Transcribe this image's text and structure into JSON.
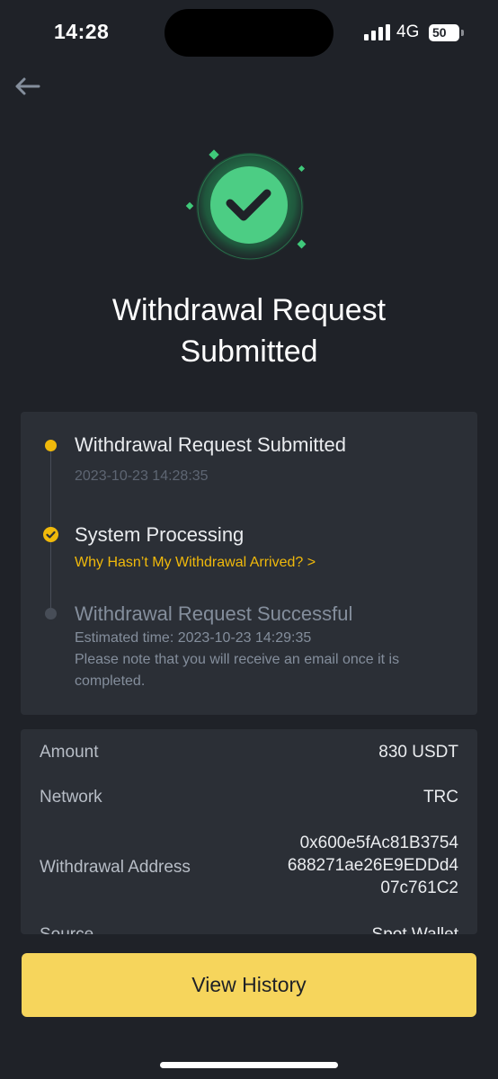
{
  "status_bar": {
    "time": "14:28",
    "network": "4G",
    "battery": "50"
  },
  "icons": {
    "back": "back-arrow-icon",
    "success": "check-circle-icon",
    "signal": "signal-icon"
  },
  "page_title": {
    "line1": "Withdrawal Request",
    "line2": "Submitted"
  },
  "timeline": {
    "steps": [
      {
        "title": "Withdrawal Request Submitted",
        "timestamp": "2023-10-23 14:28:35",
        "state": "done"
      },
      {
        "title": "System Processing",
        "link": "Why Hasn’t My Withdrawal Arrived? >",
        "state": "current"
      },
      {
        "title": "Withdrawal Request Successful",
        "estimated_label": "Estimated time:",
        "estimated_value": "2023-10-23 14:29:35",
        "note": "Please note that you will receive an email once it is completed.",
        "state": "pending"
      }
    ]
  },
  "details": {
    "amount_label": "Amount",
    "amount_value": "830 USDT",
    "network_label": "Network",
    "network_value": "TRC",
    "address_label": "Withdrawal Address",
    "address_lines": [
      "0x600e5fAc81B3754",
      "688271ae26E9EDDd4",
      "07c761C2"
    ],
    "source_label": "Source",
    "source_value": "Spot Wallet"
  },
  "actions": {
    "view_history": "View History"
  },
  "colors": {
    "background": "#1f2228",
    "card": "#2b2f36",
    "accent_yellow": "#f0b90b",
    "button_yellow": "#f6d55c",
    "success_green": "#3fc97a"
  }
}
